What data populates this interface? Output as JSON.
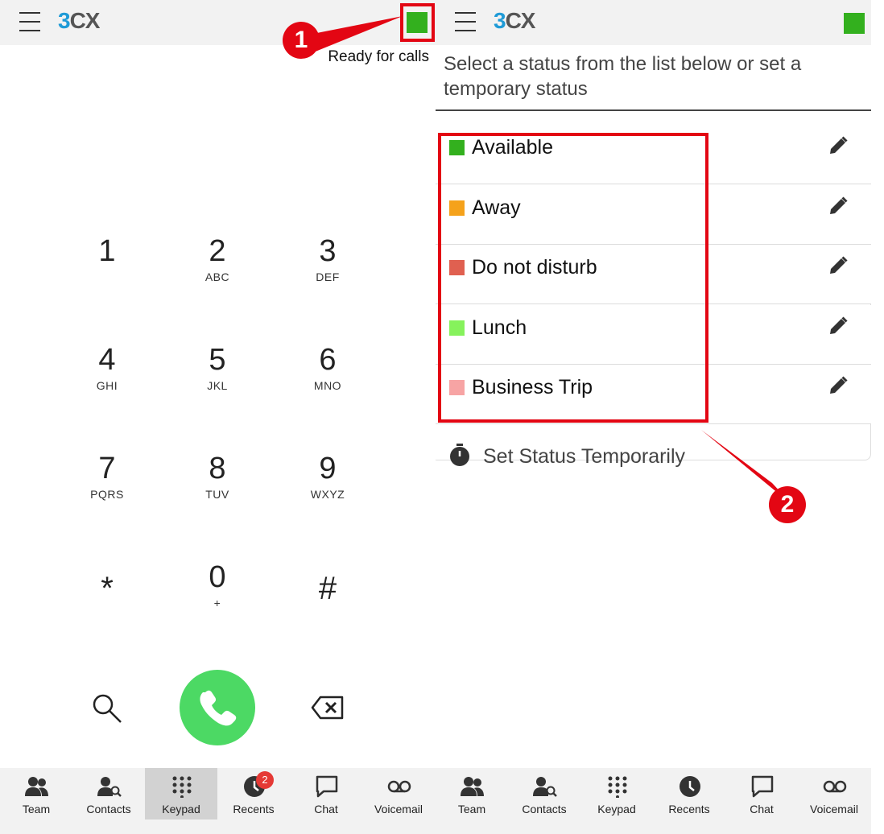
{
  "app": {
    "logo_main": "3",
    "logo_sub": "CX"
  },
  "left": {
    "status_color": "#33b01e",
    "status_text": "Ready for calls",
    "keypad": [
      {
        "digit": "1",
        "letters": ""
      },
      {
        "digit": "2",
        "letters": "ABC"
      },
      {
        "digit": "3",
        "letters": "DEF"
      },
      {
        "digit": "4",
        "letters": "GHI"
      },
      {
        "digit": "5",
        "letters": "JKL"
      },
      {
        "digit": "6",
        "letters": "MNO"
      },
      {
        "digit": "7",
        "letters": "PQRS"
      },
      {
        "digit": "8",
        "letters": "TUV"
      },
      {
        "digit": "9",
        "letters": "WXYZ"
      },
      {
        "digit": "*",
        "letters": ""
      },
      {
        "digit": "0",
        "letters": "+"
      },
      {
        "digit": "#",
        "letters": ""
      }
    ],
    "callout_number": "1",
    "nav": [
      {
        "label": "Team",
        "icon": "team-icon"
      },
      {
        "label": "Contacts",
        "icon": "contacts-icon"
      },
      {
        "label": "Keypad",
        "icon": "keypad-icon"
      },
      {
        "label": "Recents",
        "icon": "recents-icon",
        "badge": "2"
      },
      {
        "label": "Chat",
        "icon": "chat-icon"
      },
      {
        "label": "Voicemail",
        "icon": "voicemail-icon"
      }
    ]
  },
  "right": {
    "status_color": "#33b01e",
    "prompt": "Select a status from the list below or set a temporary status",
    "statuses": [
      {
        "name": "Available",
        "color": "#33b01e"
      },
      {
        "name": "Away",
        "color": "#f5a21b"
      },
      {
        "name": "Do not disturb",
        "color": "#e06050"
      },
      {
        "name": "Lunch",
        "color": "#86f25c"
      },
      {
        "name": "Business Trip",
        "color": "#f7a4a4"
      }
    ],
    "temporary_label": "Set Status Temporarily",
    "callout_number": "2",
    "nav": [
      {
        "label": "Team"
      },
      {
        "label": "Contacts"
      },
      {
        "label": "Keypad"
      },
      {
        "label": "Recents"
      },
      {
        "label": "Chat"
      },
      {
        "label": "Voicemail"
      }
    ]
  },
  "colors": {
    "accent_red": "#e30613",
    "call_green": "#4cd964",
    "nav_bg": "#f2f2f2"
  }
}
